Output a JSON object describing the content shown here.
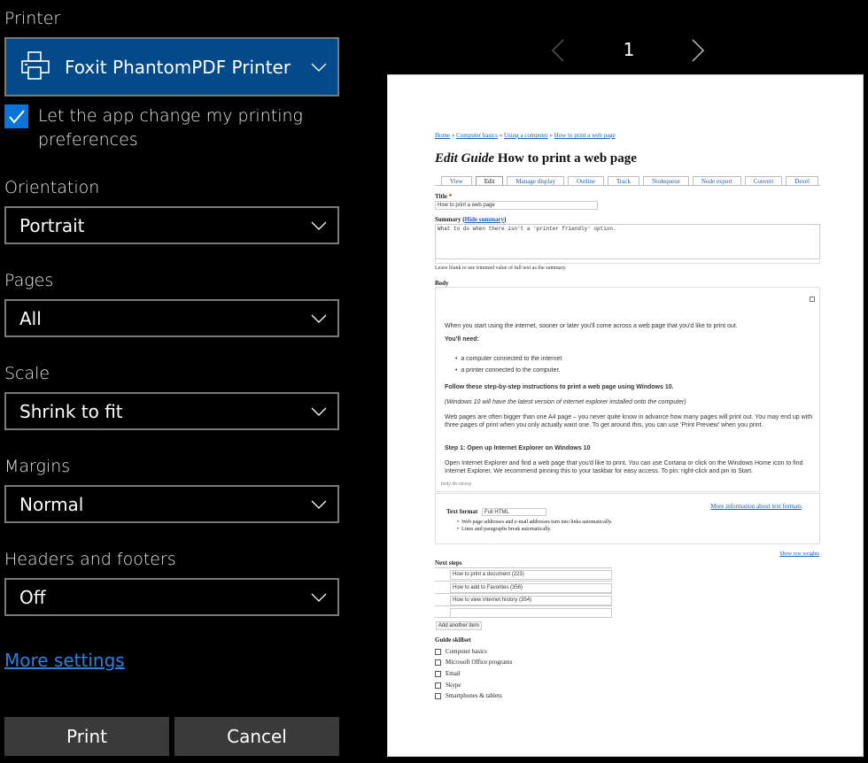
{
  "settings": {
    "printer": {
      "label": "Printer",
      "value": "Foxit PhantomPDF Printer",
      "icon": "printer-icon",
      "bg_color": "#034a8a"
    },
    "app_prefs": {
      "checked": true,
      "label": "Let the app change my printing preferences"
    },
    "orientation": {
      "label": "Orientation",
      "value": "Portrait"
    },
    "pages": {
      "label": "Pages",
      "value": "All"
    },
    "scale": {
      "label": "Scale",
      "value": "Shrink to fit"
    },
    "margins": {
      "label": "Margins",
      "value": "Normal"
    },
    "headers_footers": {
      "label": "Headers and footers",
      "value": "Off"
    },
    "more_settings": "More settings",
    "print_label": "Print",
    "cancel_label": "Cancel",
    "accent_color": "#0a74d6",
    "link_color": "#2a82e4"
  },
  "preview": {
    "page_number": "1",
    "breadcrumbs": [
      "Home",
      "Computer basics",
      "Using a computer",
      "How to print a web page"
    ],
    "title_prefix": "Edit Guide",
    "title": "How to print a web page",
    "tabs": [
      "View",
      "Edit",
      "Manage display",
      "Outline",
      "Track",
      "Nodequeue",
      "Node export",
      "Convert",
      "Devel"
    ],
    "active_tab": "Edit",
    "title_label": "Title",
    "required_mark": "*",
    "title_value": "How to print a web page",
    "summary_label": "Summary (",
    "hide_summary": "Hide summary",
    "summary_close": ")",
    "summary_value": "What to do when there isn't a 'printer friendly' option.",
    "summary_hint": "Leave blank to use trimmed value of full text as the summary.",
    "body_label": "Body",
    "body": {
      "intro": "When you start using the internet, sooner or later you'll come across a web page that you'd like to print out.",
      "need_heading": "You'll need:",
      "needs": [
        "a computer connected to the internet",
        "a printer connected to the computer."
      ],
      "follow": "Follow these step-by-step instructions to print a web page using Windows 10.",
      "note": "(Windows 10 will have the latest version of internet explorer installed onto the computer)",
      "para": "Web pages are often bigger than one A4 page – you never quite know in advance how many pages will print out. You may end up with three pages of print when you only actually want one. To get around this, you can use ‘Print Preview’ when you print.",
      "step1": "Step 1: Open up Internet Explorer on Windows 10",
      "step1_text": "Open Internet Explorer and find a web page that you'd like to print. You can use Cortana or click on the Windows Home icon to find Internet Explorer. We recommend pinning this to your taskbar for easy access. To pin: right-click and pin to Start.",
      "path": "body  div  strong"
    },
    "text_format_label": "Text format",
    "text_format_value": "Full HTML",
    "format_tips": [
      "Web page addresses and e-mail addresses turn into links automatically.",
      "Lines and paragraphs break automatically."
    ],
    "more_formats": "More information about text formats",
    "show_row_weights": "Show row weights",
    "next_steps_label": "Next steps",
    "next_steps": [
      "How to print a document (223)",
      "How to add to Favorites  (356)",
      "How to view internet history (354)",
      ""
    ],
    "add_item": "Add another item",
    "skillset_label": "Guide skillset",
    "skillset": [
      "Computer basics",
      "Microsoft Office programs",
      "Email",
      "Skype",
      "Smartphones & tablets"
    ]
  }
}
